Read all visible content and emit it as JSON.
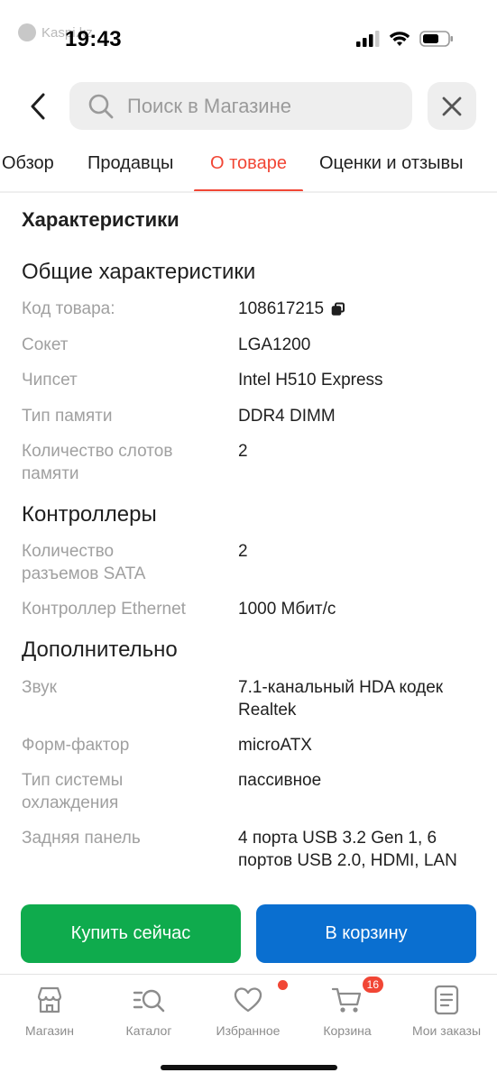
{
  "status_bar": {
    "watermark": "Kaspi.kz",
    "time": "19:43"
  },
  "search": {
    "placeholder": "Поиск в Магазине"
  },
  "tabs": [
    {
      "label": "Обзор"
    },
    {
      "label": "Продавцы"
    },
    {
      "label": "О товаре",
      "active": true
    },
    {
      "label": "Оценки и отзывы"
    }
  ],
  "characteristics": {
    "title": "Характеристики",
    "groups": [
      {
        "title": "Общие характеристики",
        "rows": [
          {
            "label": "Код товара:",
            "value": "108617215"
          },
          {
            "label": "Сокет",
            "value": "LGA1200"
          },
          {
            "label": "Чипсет",
            "value": "Intel H510 Express"
          },
          {
            "label": "Тип памяти",
            "value": "DDR4 DIMM"
          },
          {
            "label": "Количество слотов памяти",
            "value": "2"
          }
        ]
      },
      {
        "title": "Контроллеры",
        "rows": [
          {
            "label": "Количество разъемов SATA",
            "value": "2"
          },
          {
            "label": "Контроллер Ethernet",
            "value": "1000 Мбит/с"
          }
        ]
      },
      {
        "title": "Дополнительно",
        "rows": [
          {
            "label": "Звук",
            "value": "7.1-канальный HDA кодек Realtek"
          },
          {
            "label": "Форм-фактор",
            "value": "microATX"
          },
          {
            "label": "Тип системы охлаждения",
            "value": "пассивное"
          },
          {
            "label": "Задняя панель",
            "value": "4 порта USB 3.2 Gen 1, 6 портов USB 2.0, HDMI, LAN"
          }
        ]
      }
    ]
  },
  "actions": {
    "buy_now": "Купить сейчас",
    "add_to_cart": "В корзину"
  },
  "bottom_nav": [
    {
      "label": "Магазин",
      "icon": "store-icon"
    },
    {
      "label": "Каталог",
      "icon": "catalog-icon"
    },
    {
      "label": "Избранное",
      "icon": "heart-icon"
    },
    {
      "label": "Корзина",
      "icon": "cart-icon",
      "badge": "16"
    },
    {
      "label": "Мои заказы",
      "icon": "orders-icon"
    }
  ],
  "colors": {
    "accent": "#f14635",
    "buy_button": "#0fab4d",
    "cart_button": "#0a6fd0"
  }
}
